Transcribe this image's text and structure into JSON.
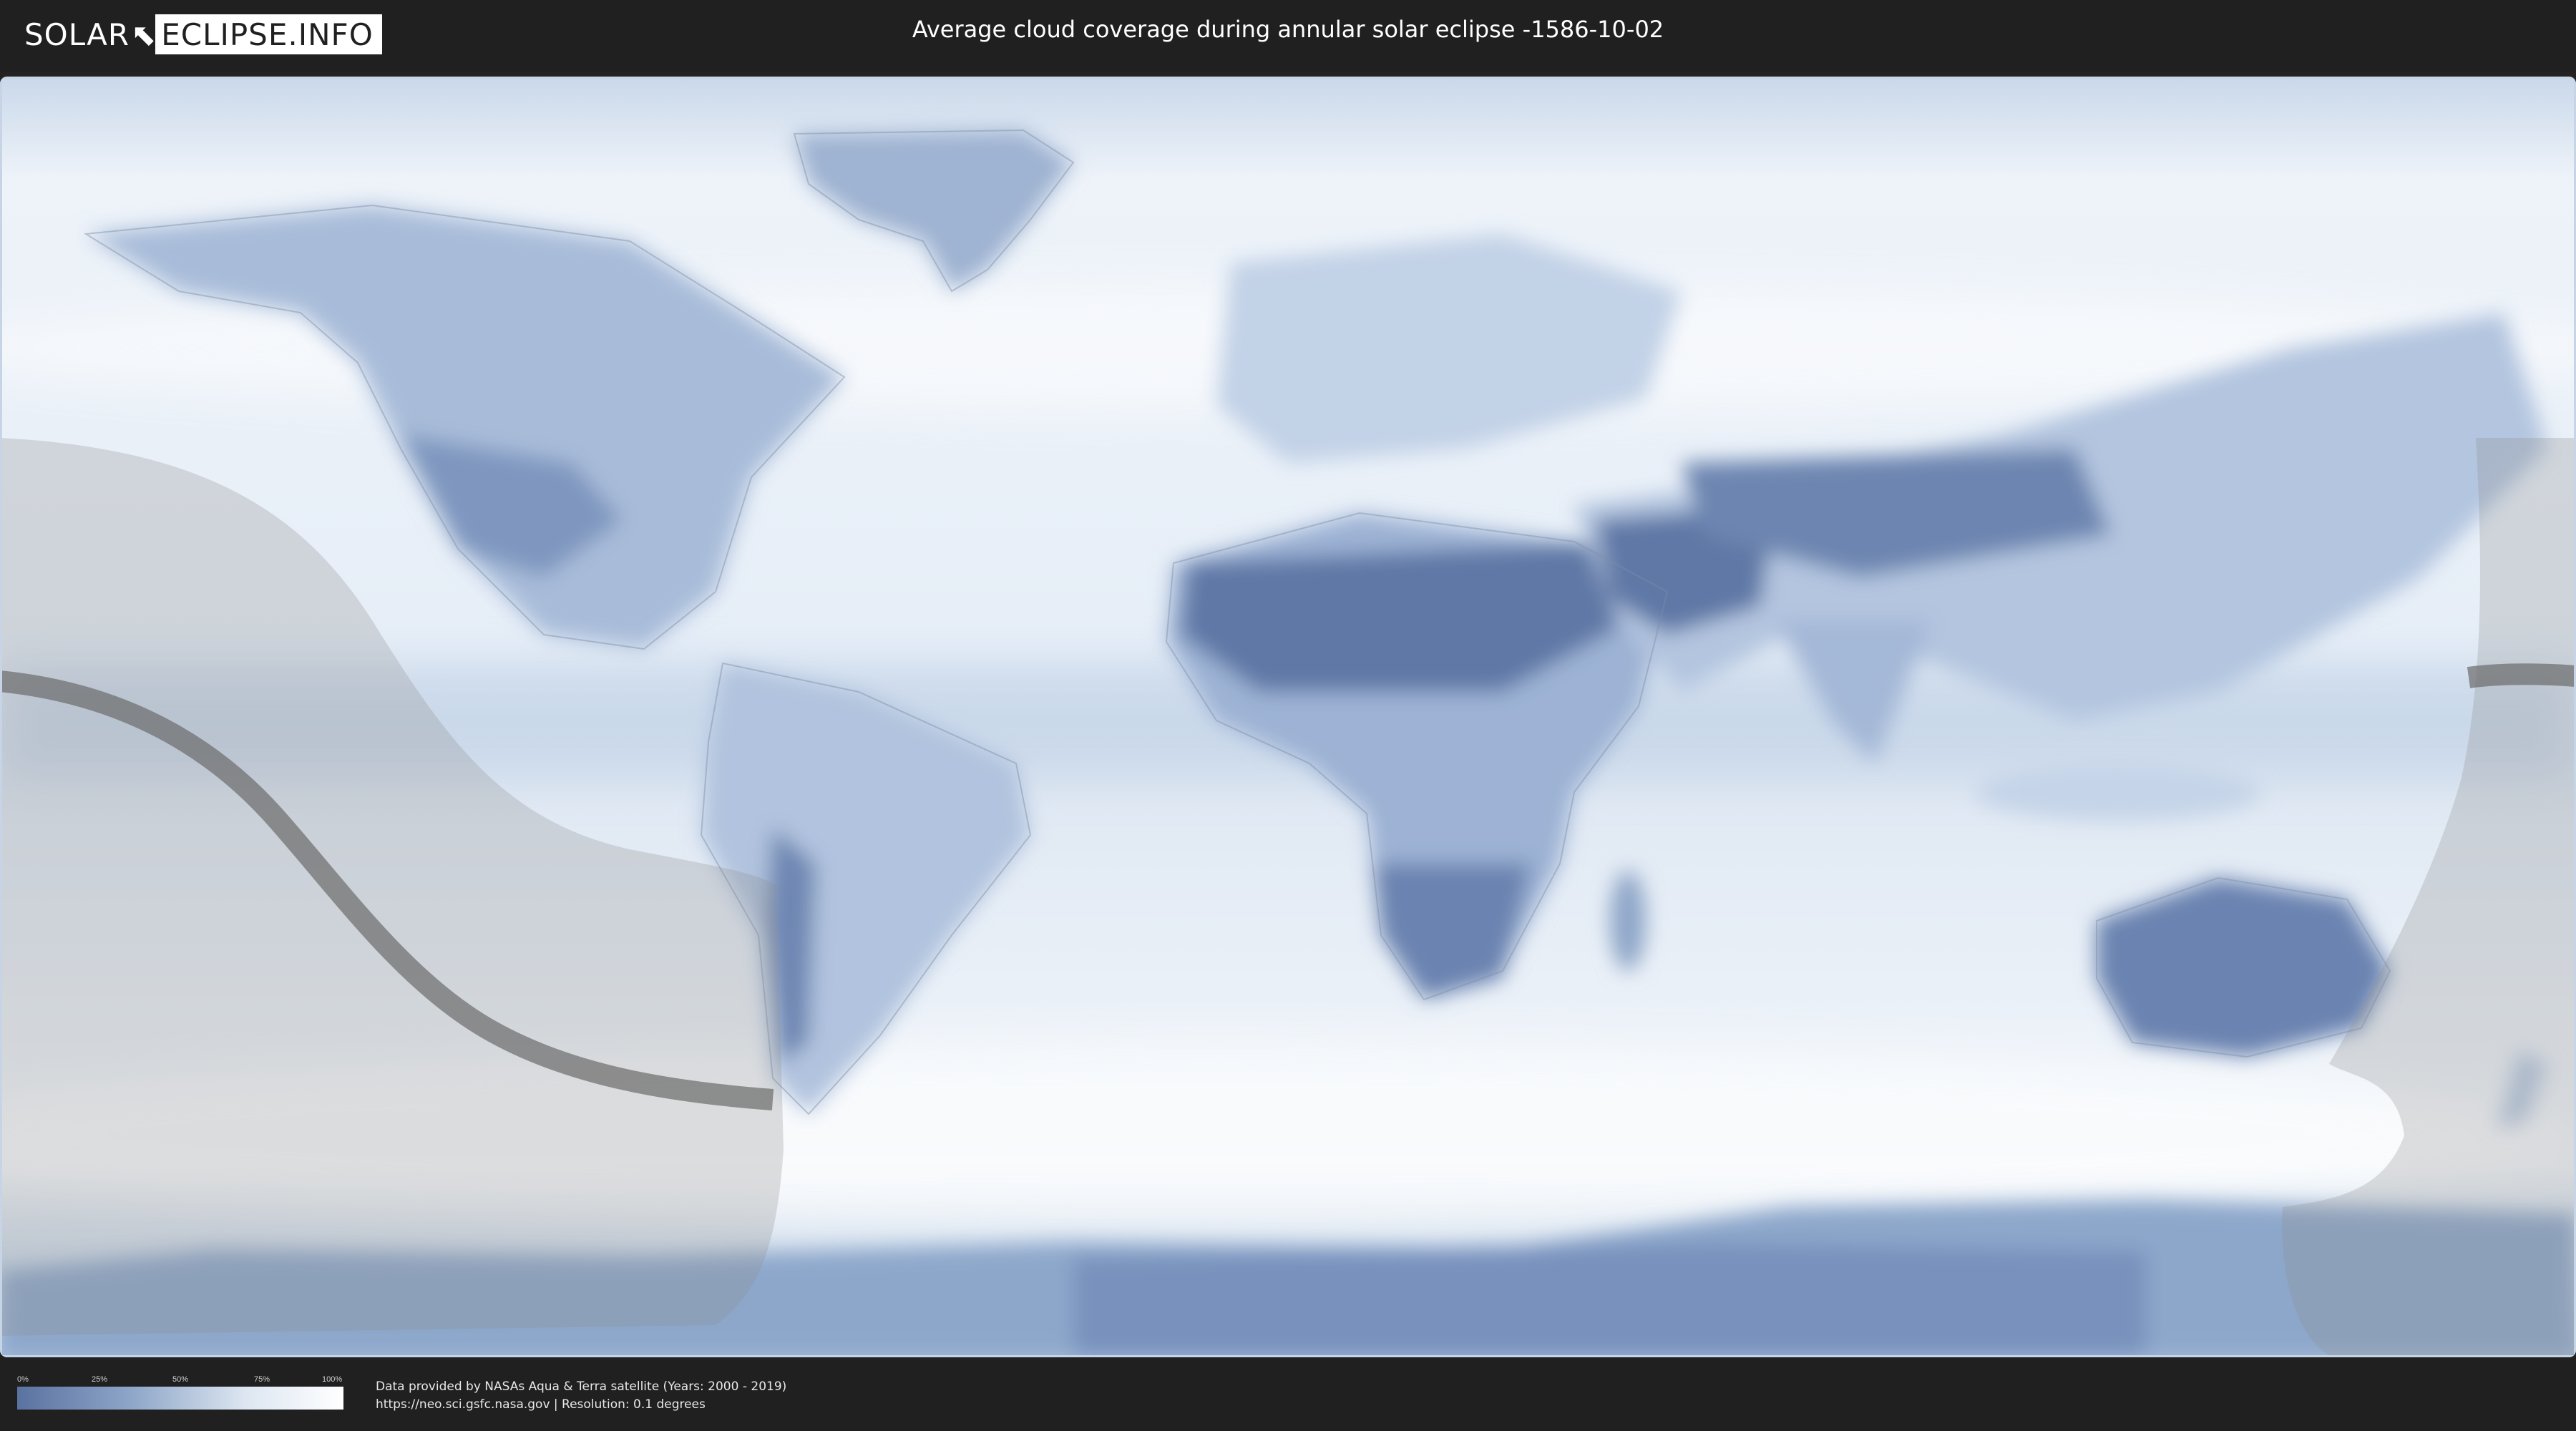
{
  "header": {
    "logo_part1": "SOLAR",
    "logo_part2": "ECLIPSE.INFO",
    "title": "Average cloud coverage during annular solar eclipse -1586-10-02"
  },
  "legend": {
    "ticks": [
      "0%",
      "25%",
      "50%",
      "75%",
      "100%"
    ],
    "colors": {
      "low": "#5a72a0",
      "mid": "#8ea6c8",
      "high": "#ffffff"
    }
  },
  "credits": {
    "line1": "Data provided by NASAs Aqua & Terra satellite (Years: 2000 - 2019)",
    "line2": "https://neo.sci.gsfc.nasa.gov | Resolution: 0.1 degrees"
  },
  "map": {
    "colors": {
      "ocean_cloud": "#eef3f9",
      "clear_land": "#6f88b3",
      "shadow_zone": "#9a9a9a",
      "central_path": "#6b6b6b"
    }
  }
}
